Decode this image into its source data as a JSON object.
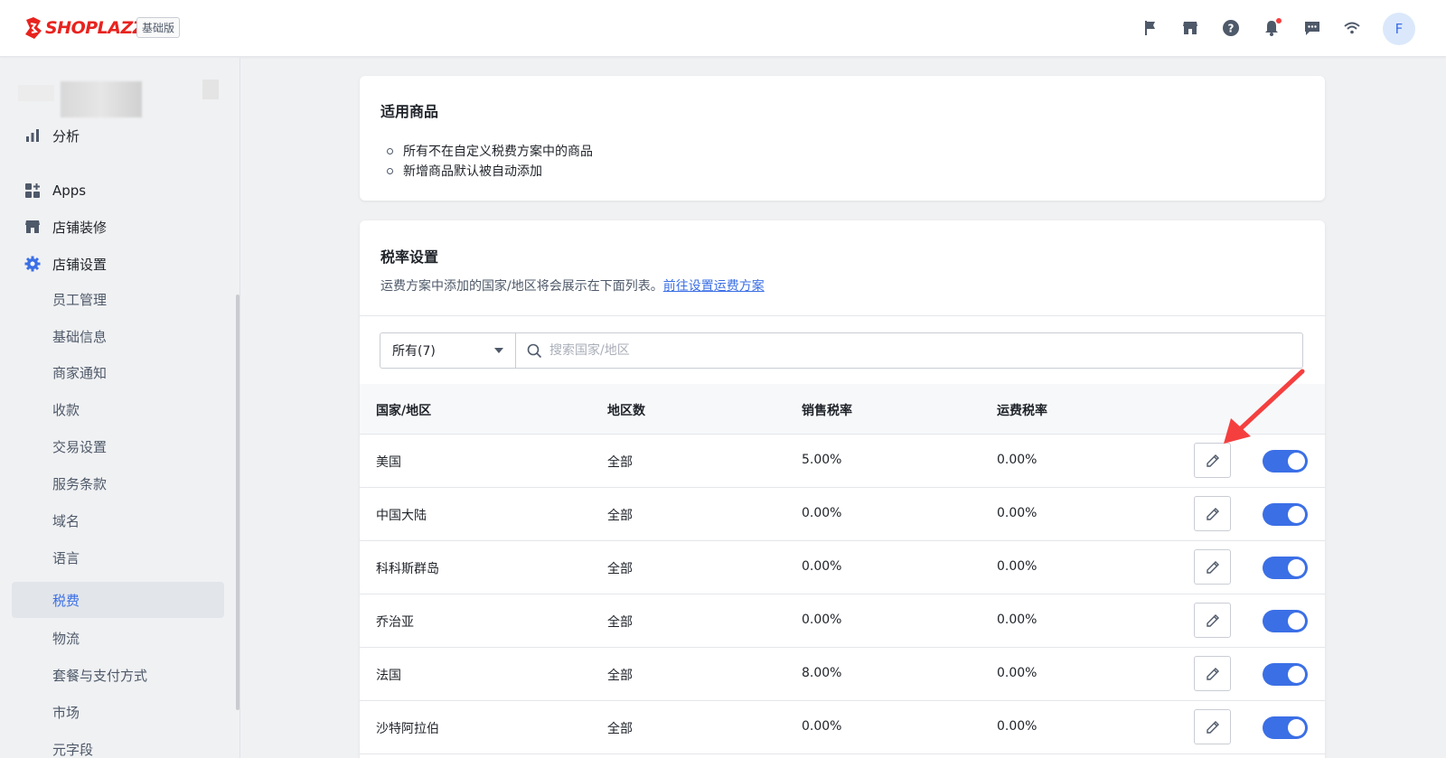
{
  "header": {
    "brand": "SHOPLAZZA",
    "edition_badge": "基础版",
    "avatar_initial": "F",
    "icons": [
      "flag-icon",
      "store-icon",
      "help-icon",
      "bell-icon",
      "chat-icon",
      "wifi-icon"
    ]
  },
  "sidebar": {
    "items": [
      {
        "label": "分析",
        "icon": "bar-chart-icon"
      },
      {
        "label": "Apps",
        "icon": "apps-grid-icon"
      },
      {
        "label": "店铺装修",
        "icon": "store-icon"
      },
      {
        "label": "店铺设置",
        "icon": "gear-icon"
      }
    ],
    "sub_items": [
      "员工管理",
      "基础信息",
      "商家通知",
      "收款",
      "交易设置",
      "服务条款",
      "域名",
      "语言",
      "税费",
      "物流",
      "套餐与支付方式",
      "市场",
      "元字段"
    ],
    "active_sub_item": "税费",
    "accent_color": "#3b6fe6"
  },
  "applicable_products": {
    "title": "适用商品",
    "bullets": [
      "所有不在自定义税费方案中的商品",
      "新增商品默认被自动添加"
    ]
  },
  "tax_settings": {
    "title": "税率设置",
    "description": "运费方案中添加的国家/地区将会展示在下面列表。",
    "link_text": "前往设置运费方案",
    "filter": {
      "selected": "所有(7)",
      "search_placeholder": "搜索国家/地区"
    },
    "columns": [
      "国家/地区",
      "地区数",
      "销售税率",
      "运费税率"
    ],
    "rows": [
      {
        "country": "美国",
        "regions": "全部",
        "sales_tax": "5.00%",
        "shipping_tax": "0.00%",
        "enabled": true
      },
      {
        "country": "中国大陆",
        "regions": "全部",
        "sales_tax": "0.00%",
        "shipping_tax": "0.00%",
        "enabled": true
      },
      {
        "country": "科科斯群岛",
        "regions": "全部",
        "sales_tax": "0.00%",
        "shipping_tax": "0.00%",
        "enabled": true
      },
      {
        "country": "乔治亚",
        "regions": "全部",
        "sales_tax": "0.00%",
        "shipping_tax": "0.00%",
        "enabled": true
      },
      {
        "country": "法国",
        "regions": "全部",
        "sales_tax": "8.00%",
        "shipping_tax": "0.00%",
        "enabled": true
      },
      {
        "country": "沙特阿拉伯",
        "regions": "全部",
        "sales_tax": "0.00%",
        "shipping_tax": "0.00%",
        "enabled": true
      }
    ],
    "toggle_color": "#3b6fe6",
    "annotation_arrow_color": "#f53f3f"
  }
}
